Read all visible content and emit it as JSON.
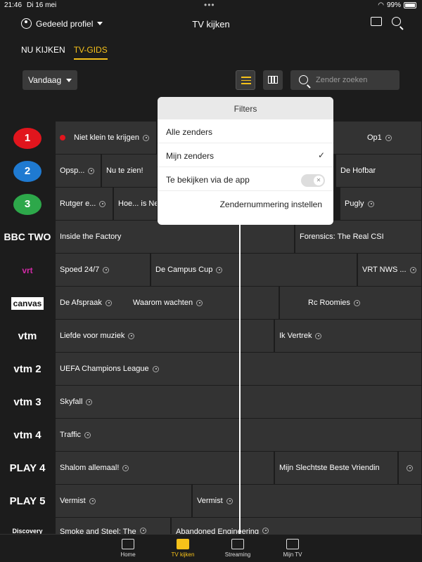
{
  "status": {
    "time": "21:46",
    "date": "Di 16 mei",
    "battery": "99%"
  },
  "header": {
    "profile": "Gedeeld profiel",
    "title": "TV kijken"
  },
  "tabs": [
    {
      "label": "NU KIJKEN"
    },
    {
      "label": "TV-GIDS"
    }
  ],
  "controls": {
    "day": "Vandaag",
    "search_placeholder": "Zender zoeken"
  },
  "filters": {
    "title": "Filters",
    "items": [
      "Alle zenders",
      "Mijn zenders",
      "Te bekijken via de app"
    ],
    "link": "Zendernummering instellen",
    "check": "✓"
  },
  "channels": [
    {
      "logo": "1",
      "cells": [
        "Niet klein te krijgen",
        "Op1"
      ]
    },
    {
      "logo": "2",
      "cells": [
        "Opsp...",
        "Nu te zien!",
        "De Hofbar"
      ]
    },
    {
      "logo": "3",
      "cells": [
        "Rutger e...",
        "Hoe... is Ned",
        "Pugly"
      ]
    },
    {
      "logo": "BBC TWO",
      "cells": [
        "Inside the Factory",
        "Forensics: The Real CSI"
      ]
    },
    {
      "logo": "vrt",
      "cells": [
        "Spoed 24/7",
        "De Campus Cup",
        "VRT NWS ..."
      ]
    },
    {
      "logo": "canvas",
      "cells": [
        "De Afspraak",
        "Waarom wachten",
        "Rc Roomies"
      ]
    },
    {
      "logo": "vtm",
      "cells": [
        "Liefde voor muziek",
        "Ik Vertrek"
      ]
    },
    {
      "logo": "vtm 2",
      "cells": [
        "UEFA Champions League"
      ]
    },
    {
      "logo": "vtm 3",
      "cells": [
        "Skyfall"
      ]
    },
    {
      "logo": "vtm 4",
      "cells": [
        "Traffic"
      ]
    },
    {
      "logo": "PLAY 4",
      "cells": [
        "Shalom allemaal!",
        "Mijn Slechtste Beste Vriendin"
      ]
    },
    {
      "logo": "PLAY 5",
      "cells": [
        "Vermist",
        "Vermist"
      ]
    },
    {
      "logo": "Discovery",
      "cells": [
        "Smoke and Steel: The",
        "Abandoned Engineering"
      ]
    }
  ],
  "bottom_nav": [
    {
      "label": "Home"
    },
    {
      "label": "TV kijken"
    },
    {
      "label": "Streaming"
    },
    {
      "label": "Mijn TV"
    }
  ],
  "colors": {
    "accent": "#f7c21a",
    "npo": "#e1151d",
    "background": "#1c1c1c"
  }
}
